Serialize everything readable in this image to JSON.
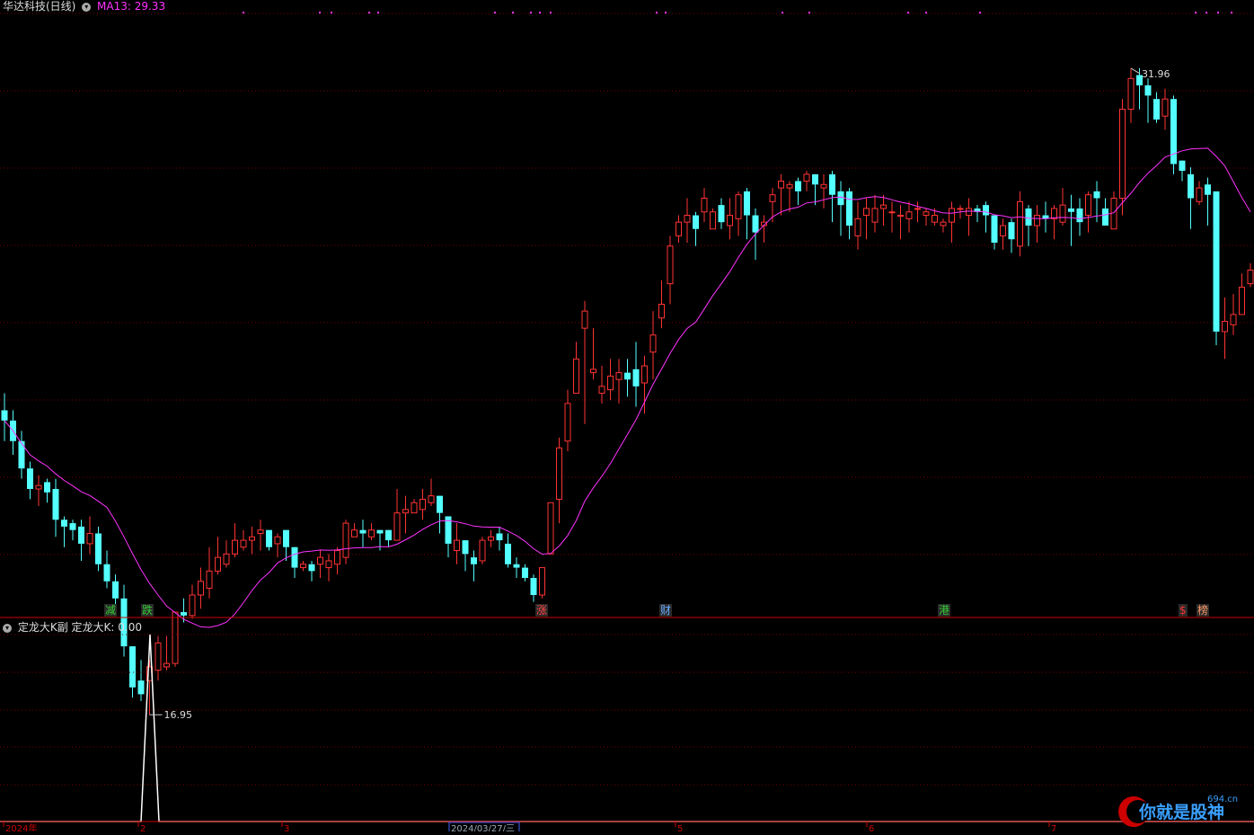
{
  "header": {
    "stock_title": "华达科技(日线)",
    "ma_label": "MA13: 29.33"
  },
  "main_chart": {
    "high_label": "31.96",
    "low_label": "16.95"
  },
  "signal_tags": [
    {
      "text": "减",
      "color": "#33cc33"
    },
    {
      "text": "跌",
      "color": "#33cc33"
    },
    {
      "text": "涨",
      "color": "#ff4444"
    },
    {
      "text": "财",
      "color": "#66aaff"
    },
    {
      "text": "港",
      "color": "#33cc33"
    },
    {
      "text": "$",
      "color": "#ff3333"
    },
    {
      "text": "榜",
      "color": "#ff9966"
    }
  ],
  "sub_chart": {
    "title": "定龙大K副",
    "value_label": "定龙大K: 0.00"
  },
  "date_axis": {
    "labels": [
      "2024年",
      "2",
      "3",
      "2024/03/27/三",
      "5",
      "6",
      "7"
    ]
  },
  "watermark": {
    "text": "你就是股神",
    "site": "694.cn"
  },
  "colors": {
    "up": "#ff3333",
    "down": "#54ffff",
    "ma": "#ff33ff",
    "grid": "#7a0000"
  },
  "chart_data": {
    "type": "candlestick",
    "ylim": [
      16.5,
      33.5
    ],
    "ma_period": 13,
    "candles": [
      [
        21.9,
        21.6,
        22.4,
        21.0
      ],
      [
        21.6,
        21.0,
        21.9,
        20.6
      ],
      [
        21.0,
        20.2,
        21.3,
        19.9
      ],
      [
        20.2,
        19.6,
        20.4,
        19.3
      ],
      [
        19.6,
        19.7,
        20.0,
        19.1
      ],
      [
        19.8,
        19.5,
        19.9,
        19.2
      ],
      [
        19.6,
        18.7,
        19.9,
        18.2
      ],
      [
        18.7,
        18.5,
        18.8,
        17.9
      ],
      [
        18.6,
        18.4,
        18.7,
        18.1
      ],
      [
        18.5,
        18.0,
        18.7,
        17.5
      ],
      [
        18.0,
        18.3,
        18.8,
        17.7
      ],
      [
        18.3,
        17.4,
        18.5,
        17.2
      ],
      [
        17.4,
        16.9,
        17.8,
        16.7
      ],
      [
        16.9,
        16.4,
        17.1,
        16.1
      ],
      [
        16.4,
        15.0,
        16.8,
        14.7
      ],
      [
        15.0,
        13.8,
        15.0,
        13.5
      ],
      [
        14.0,
        13.6,
        14.6,
        13.4
      ],
      [
        14.0,
        14.4,
        14.6,
        13.0
      ],
      [
        14.3,
        15.1,
        15.3,
        14.0
      ],
      [
        14.4,
        14.5,
        15.3,
        14.3
      ],
      [
        14.5,
        16.0,
        16.0,
        14.4
      ],
      [
        16.0,
        15.9,
        16.4,
        15.7
      ],
      [
        15.9,
        16.5,
        16.8,
        15.8
      ],
      [
        16.5,
        16.9,
        17.3,
        16.1
      ],
      [
        16.7,
        17.2,
        17.9,
        16.4
      ],
      [
        17.2,
        17.6,
        18.2,
        17.1
      ],
      [
        17.4,
        17.7,
        18.1,
        17.3
      ],
      [
        17.7,
        18.1,
        18.6,
        17.6
      ],
      [
        17.9,
        18.1,
        18.4,
        17.8
      ],
      [
        18.1,
        18.2,
        18.5,
        17.7
      ],
      [
        18.3,
        18.4,
        18.7,
        17.8
      ],
      [
        18.4,
        17.9,
        18.4,
        17.8
      ],
      [
        18.0,
        18.2,
        18.3,
        17.6
      ],
      [
        18.4,
        17.9,
        18.4,
        17.5
      ],
      [
        17.9,
        17.3,
        17.9,
        17.0
      ],
      [
        17.3,
        17.4,
        17.5,
        17.2
      ],
      [
        17.4,
        17.2,
        17.5,
        16.9
      ],
      [
        17.4,
        17.6,
        17.8,
        17.0
      ],
      [
        17.3,
        17.5,
        17.7,
        16.9
      ],
      [
        17.4,
        17.8,
        17.9,
        17.1
      ],
      [
        17.6,
        18.6,
        18.7,
        17.4
      ],
      [
        18.2,
        18.4,
        18.6,
        18.2
      ],
      [
        18.4,
        18.3,
        18.7,
        17.9
      ],
      [
        18.2,
        18.4,
        18.6,
        18.1
      ],
      [
        18.4,
        18.3,
        18.4,
        17.8
      ],
      [
        18.4,
        18.1,
        18.4,
        17.9
      ],
      [
        18.1,
        18.9,
        19.6,
        18.1
      ],
      [
        18.9,
        19.0,
        19.4,
        18.3
      ],
      [
        18.9,
        19.2,
        19.3,
        18.9
      ],
      [
        19.0,
        19.3,
        19.6,
        18.7
      ],
      [
        19.2,
        19.4,
        19.9,
        19.1
      ],
      [
        19.4,
        18.9,
        19.4,
        18.3
      ],
      [
        18.8,
        18.0,
        18.8,
        17.6
      ],
      [
        17.8,
        18.1,
        18.6,
        17.4
      ],
      [
        18.1,
        17.7,
        18.1,
        17.2
      ],
      [
        17.6,
        17.4,
        17.8,
        16.9
      ],
      [
        17.5,
        18.1,
        18.2,
        17.4
      ],
      [
        18.1,
        18.2,
        18.4,
        17.9
      ],
      [
        18.3,
        18.1,
        18.5,
        17.8
      ],
      [
        18.0,
        17.4,
        18.3,
        17.3
      ],
      [
        17.4,
        17.3,
        17.6,
        17.0
      ],
      [
        17.3,
        17.0,
        17.4,
        16.9
      ],
      [
        17.0,
        16.5,
        17.1,
        16.3
      ],
      [
        16.5,
        17.3,
        17.3,
        16.4
      ],
      [
        17.7,
        19.2,
        19.2,
        17.7
      ],
      [
        19.3,
        20.8,
        21.1,
        18.6
      ],
      [
        21.0,
        22.1,
        22.5,
        20.7
      ],
      [
        22.4,
        23.4,
        23.9,
        22.5
      ],
      [
        24.3,
        24.8,
        25.1,
        21.5
      ],
      [
        23.0,
        23.1,
        24.3,
        22.8
      ],
      [
        22.4,
        22.6,
        23.2,
        22.1
      ],
      [
        22.5,
        22.9,
        23.4,
        22.2
      ],
      [
        22.8,
        23.0,
        23.4,
        22.1
      ],
      [
        23.0,
        22.8,
        23.4,
        22.3
      ],
      [
        23.1,
        22.6,
        23.9,
        22.0
      ],
      [
        22.7,
        23.2,
        23.5,
        21.8
      ],
      [
        23.6,
        24.1,
        24.8,
        22.8
      ],
      [
        24.6,
        25.0,
        25.7,
        24.3
      ],
      [
        25.6,
        26.7,
        27.0,
        25.0
      ],
      [
        27.0,
        27.4,
        27.6,
        26.8
      ],
      [
        27.4,
        27.6,
        28.1,
        26.8
      ],
      [
        27.6,
        27.2,
        27.7,
        26.7
      ],
      [
        27.7,
        28.1,
        28.4,
        27.4
      ],
      [
        27.2,
        27.7,
        27.8,
        27.2
      ],
      [
        27.9,
        27.4,
        28.1,
        27.2
      ],
      [
        27.3,
        27.6,
        28.1,
        26.9
      ],
      [
        27.5,
        28.2,
        28.3,
        27.0
      ],
      [
        28.3,
        27.6,
        28.4,
        26.9
      ],
      [
        27.6,
        27.1,
        27.8,
        26.3
      ],
      [
        27.3,
        27.4,
        27.6,
        26.8
      ],
      [
        28.0,
        28.2,
        28.4,
        27.4
      ],
      [
        28.4,
        28.6,
        28.8,
        27.6
      ],
      [
        28.4,
        28.5,
        28.6,
        27.7
      ],
      [
        28.6,
        28.3,
        28.7,
        27.9
      ],
      [
        28.6,
        28.8,
        28.9,
        28.3
      ],
      [
        28.8,
        28.5,
        28.8,
        27.9
      ],
      [
        28.4,
        28.5,
        28.8,
        27.8
      ],
      [
        28.8,
        28.2,
        28.9,
        27.4
      ],
      [
        28.3,
        27.9,
        28.6,
        27.0
      ],
      [
        28.3,
        27.3,
        28.4,
        26.9
      ],
      [
        27.0,
        27.5,
        28.0,
        26.6
      ],
      [
        27.6,
        27.8,
        28.1,
        26.9
      ],
      [
        27.4,
        27.8,
        28.2,
        27.1
      ],
      [
        27.8,
        27.9,
        28.2,
        27.3
      ],
      [
        27.7,
        27.7,
        28.0,
        27.1
      ],
      [
        27.6,
        27.6,
        27.9,
        26.9
      ],
      [
        27.5,
        27.7,
        28.0,
        27.1
      ],
      [
        27.8,
        27.8,
        28.0,
        27.4
      ],
      [
        27.6,
        27.7,
        27.8,
        27.3
      ],
      [
        27.4,
        27.6,
        27.8,
        27.3
      ],
      [
        27.3,
        27.4,
        27.5,
        27.1
      ],
      [
        27.4,
        27.8,
        28.0,
        26.8
      ],
      [
        27.8,
        27.8,
        27.9,
        27.5
      ],
      [
        27.6,
        27.8,
        28.1,
        27.0
      ],
      [
        27.8,
        27.7,
        27.9,
        27.4
      ],
      [
        27.9,
        27.6,
        28.0,
        27.1
      ],
      [
        27.6,
        26.8,
        27.6,
        26.6
      ],
      [
        27.0,
        27.3,
        27.5,
        26.6
      ],
      [
        27.4,
        26.9,
        27.5,
        26.5
      ],
      [
        26.7,
        28.0,
        28.3,
        26.4
      ],
      [
        27.8,
        27.3,
        27.9,
        26.7
      ],
      [
        27.3,
        27.6,
        27.9,
        26.8
      ],
      [
        27.6,
        27.5,
        28.0,
        27.1
      ],
      [
        27.5,
        27.8,
        27.9,
        26.9
      ],
      [
        27.4,
        27.9,
        28.4,
        27.3
      ],
      [
        27.8,
        27.7,
        28.2,
        26.7
      ],
      [
        27.8,
        27.4,
        28.1,
        27.0
      ],
      [
        27.6,
        28.2,
        28.3,
        27.1
      ],
      [
        28.3,
        28.1,
        28.6,
        27.4
      ],
      [
        27.8,
        27.3,
        28.1,
        27.3
      ],
      [
        27.2,
        28.1,
        28.3,
        27.2
      ],
      [
        28.1,
        30.7,
        31.0,
        27.6
      ],
      [
        30.7,
        31.6,
        31.9,
        30.3
      ],
      [
        31.7,
        31.4,
        31.9,
        30.7
      ],
      [
        31.4,
        31.1,
        31.6,
        30.3
      ],
      [
        31.0,
        30.4,
        31.2,
        30.3
      ],
      [
        30.5,
        31.0,
        31.3,
        30.1
      ],
      [
        31.0,
        29.1,
        31.1,
        28.8
      ],
      [
        29.2,
        28.9,
        29.2,
        28.6
      ],
      [
        28.8,
        28.1,
        29.0,
        27.2
      ],
      [
        28.0,
        28.4,
        28.6,
        27.9
      ],
      [
        28.5,
        28.2,
        28.7,
        27.3
      ],
      [
        28.3,
        24.2,
        28.2,
        23.8
      ],
      [
        24.2,
        24.5,
        25.2,
        23.4
      ],
      [
        24.4,
        24.7,
        25.3,
        24.1
      ],
      [
        24.7,
        25.5,
        25.9,
        25.1
      ],
      [
        25.6,
        26.0,
        26.2,
        25.5
      ]
    ],
    "indicator": {
      "name": "定龙大K",
      "value": 0.0,
      "spike_index": 16
    }
  }
}
